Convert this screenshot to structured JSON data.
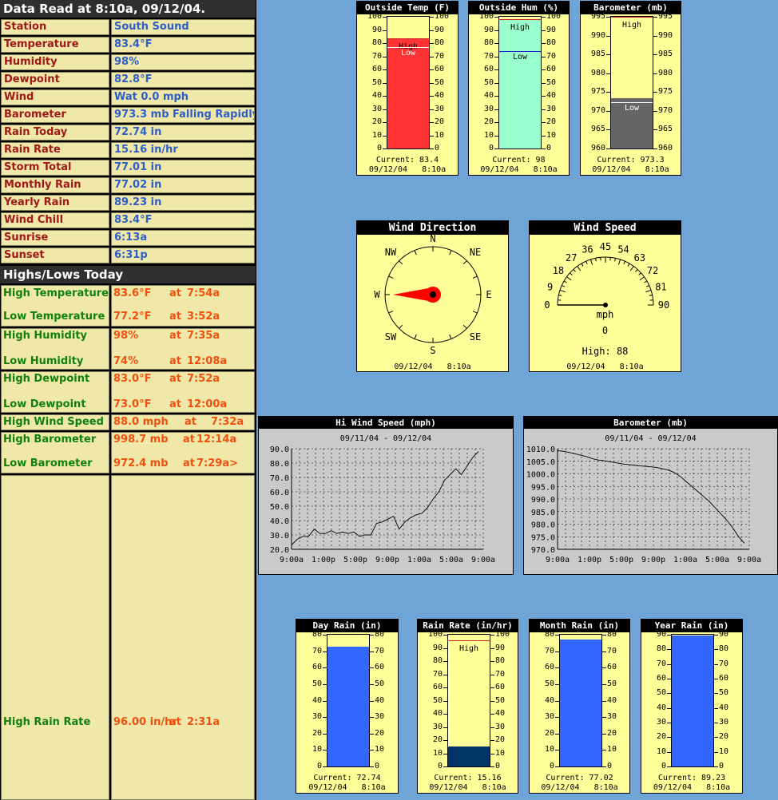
{
  "header": {
    "title": "Data Read at 8:10a, 09/12/04."
  },
  "current": [
    {
      "label": "Station",
      "value": "South Sound"
    },
    {
      "label": "Temperature",
      "value": "83.4°F"
    },
    {
      "label": "Humidity",
      "value": "98%"
    },
    {
      "label": "Dewpoint",
      "value": "82.8°F"
    },
    {
      "label": "Wind",
      "value": "Wat 0.0 mph"
    },
    {
      "label": "Barometer",
      "value": "973.3 mb Falling Rapidly"
    },
    {
      "label": "Rain Today",
      "value": "72.74 in"
    },
    {
      "label": "Rain Rate",
      "value": "15.16 in/hr"
    },
    {
      "label": "Storm Total",
      "value": "77.01 in"
    },
    {
      "label": "Monthly Rain",
      "value": "77.02 in"
    },
    {
      "label": "Yearly Rain",
      "value": "89.23 in"
    },
    {
      "label": "Wind Chill",
      "value": "83.4°F"
    },
    {
      "label": "Sunrise",
      "value": "6:13a"
    },
    {
      "label": "Sunset",
      "value": "6:31p"
    }
  ],
  "highs_lows": {
    "title": "Highs/Lows Today",
    "rows": [
      {
        "label": "High Temperature",
        "value": "83.6°F",
        "at": "at",
        "time": "7:54a"
      },
      {
        "label": "Low Temperature",
        "value": "77.2°F",
        "at": "at",
        "time": "3:52a"
      },
      {
        "label": "High Humidity",
        "value": "98%",
        "at": "at",
        "time": "7:35a"
      },
      {
        "label": "Low Humidity",
        "value": "74%",
        "at": "at",
        "time": "12:08a"
      },
      {
        "label": "High Dewpoint",
        "value": "83.0°F",
        "at": "at",
        "time": "7:52a"
      },
      {
        "label": "Low Dewpoint",
        "value": "73.0°F",
        "at": "at",
        "time": "12:00a"
      },
      {
        "label": "High Wind Speed",
        "value": "88.0 mph",
        "at": "at",
        "time": "7:32a"
      },
      {
        "label": "High Barometer",
        "value": "998.7 mb",
        "at": "at",
        "time": "12:14a"
      },
      {
        "label": "Low Barometer",
        "value": "972.4 mb",
        "at": "at",
        "time": "7:29a>"
      },
      {
        "label": "High Rain Rate",
        "value": "96.00 in/hr",
        "at": "at",
        "time": "2:31a"
      }
    ]
  },
  "stamp": {
    "date": "09/12/04",
    "time": "8:10a"
  },
  "gauges": [
    {
      "key": "temp",
      "title": "Outside Temp (F)",
      "min": 0,
      "max": 100,
      "step": 10,
      "value": 83.4,
      "high": 83.6,
      "low": 77.2,
      "high_label": "High",
      "low_label": "Low",
      "current_label": "Current: 83.4",
      "fill": "#ff3333"
    },
    {
      "key": "hum",
      "title": "Outside Hum (%)",
      "min": 0,
      "max": 100,
      "step": 10,
      "value": 98,
      "high": 98,
      "low": 74,
      "high_label": "High",
      "low_label": "Low",
      "current_label": "Current: 98",
      "fill": "#99ffcc"
    },
    {
      "key": "baro",
      "title": "Barometer (mb)",
      "min": 960,
      "max": 995,
      "step": 5,
      "value": 973.3,
      "high": 998.7,
      "low": 972.4,
      "high_label": "High",
      "low_label": "Low",
      "current_label": "Current: 973.3",
      "fill": "#666666"
    },
    {
      "key": "dayrain",
      "title": "Day Rain (in)",
      "min": 0,
      "max": 80,
      "step": 10,
      "value": 72.74,
      "current_label": "Current: 72.74",
      "fill": "#3366ff"
    },
    {
      "key": "rainrate",
      "title": "Rain Rate (in/hr)",
      "min": 0,
      "max": 100,
      "step": 10,
      "value": 15.16,
      "high": 96,
      "high_label": "High",
      "current_label": "Current: 15.16",
      "fill": "#003366"
    },
    {
      "key": "monthrain",
      "title": "Month Rain (in)",
      "min": 0,
      "max": 80,
      "step": 10,
      "value": 77.02,
      "current_label": "Current: 77.02",
      "fill": "#3366ff"
    },
    {
      "key": "yearrain",
      "title": "Year Rain (in)",
      "min": 0,
      "max": 90,
      "step": 10,
      "value": 89.23,
      "current_label": "Current: 89.23",
      "fill": "#3366ff"
    }
  ],
  "wind_direction": {
    "title": "Wind Direction",
    "compass": [
      "N",
      "NE",
      "E",
      "SE",
      "S",
      "SW",
      "W",
      "NW"
    ],
    "direction_deg": 270
  },
  "wind_speed": {
    "title": "Wind Speed",
    "scale": [
      "0",
      "9",
      "18",
      "27",
      "36",
      "45",
      "54",
      "63",
      "72",
      "81",
      "90"
    ],
    "unit": "mph",
    "value": "0",
    "high_label": "High: 88"
  },
  "chart_data": [
    {
      "type": "line",
      "title": "Hi Wind Speed (mph)",
      "subtitle": "09/11/04 - 09/12/04",
      "categories": [
        "9:00a",
        "1:00p",
        "5:00p",
        "9:00p",
        "1:00a",
        "5:00a",
        "9:00a"
      ],
      "ylim": [
        20,
        90
      ],
      "yticks": [
        "20.0",
        "30.0",
        "40.0",
        "50.0",
        "60.0",
        "70.0",
        "80.0",
        "90.0"
      ],
      "y": [
        23,
        27,
        29,
        29,
        34,
        31,
        31,
        33,
        31,
        32,
        31,
        32,
        29,
        30,
        30,
        38,
        39,
        41,
        43,
        34,
        39,
        42,
        44,
        45,
        49,
        55,
        60,
        68,
        72,
        76,
        72,
        78,
        84,
        88
      ]
    },
    {
      "type": "line",
      "title": "Barometer (mb)",
      "subtitle": "09/11/04 - 09/12/04",
      "categories": [
        "9:00a",
        "1:00p",
        "5:00p",
        "9:00p",
        "1:00a",
        "5:00a",
        "9:00a"
      ],
      "ylim": [
        970,
        1010
      ],
      "yticks": [
        "970.0",
        "975.0",
        "980.0",
        "985.0",
        "990.0",
        "995.0",
        "1000.0",
        "1005.0",
        "1010.0"
      ],
      "y": [
        1009.2,
        1009,
        1008.5,
        1008,
        1007.4,
        1006.8,
        1006,
        1005.5,
        1005.2,
        1004.8,
        1004.4,
        1004,
        1003.7,
        1003.5,
        1003.2,
        1003,
        1002.8,
        1002.5,
        1002,
        1001.5,
        1000.5,
        999,
        997,
        995,
        993,
        991,
        989,
        986.5,
        984,
        981.5,
        978.5,
        975,
        972.4
      ]
    }
  ]
}
